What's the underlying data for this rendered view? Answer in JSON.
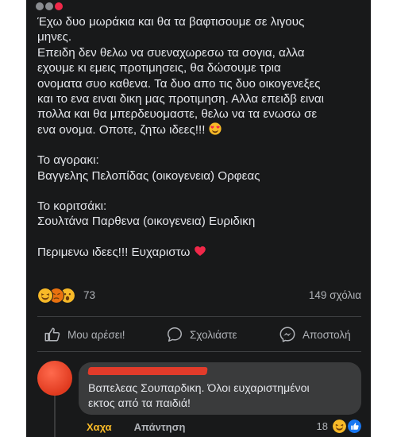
{
  "post": {
    "lines": [
      "Έχω δυο μωράκια και θα τα βαφτισουμε σε λιγους",
      "μηνες.",
      "Επειδη δεν θελω να συεναχωρεσω τα σογια, αλλα",
      "εχουμε κι εμεις προτιμησεις, θα δώσουμε τρια",
      "ονοματα συο καθενα. Τα δυο απο τις δυο οικογενεξες",
      "και το ενα ειναι δικη μας προτιμηση. Αλλα επειδβ ειναι",
      "πολλα και θα μπερδευομαστε, θελω να τα ενωσω σε",
      "ενα ονομα. Οποτε, ζητω ιδεες!!!",
      "Το αγορακι:",
      "Βαγγελης Πελοπίδας (οικογενεια) Ορφεας",
      "Το κοριτσάκι:",
      "Σουλτάνα Παρθενα (οικογενεια) Ευριδικη",
      "Περιμενω ιδεες!!! Ευχαριστω"
    ],
    "reaction_count": "73",
    "comments_count": "149 σχόλια"
  },
  "actions": {
    "like": "Μου αρέσει!",
    "comment": "Σχολιάστε",
    "share": "Αποστολή"
  },
  "comment": {
    "line1": "Βαπελεας Σουπαρδικη. Όλοι ευχαριστημένοι",
    "line2": "εκτος από τα παιδιά!",
    "laugh_label": "Χαχα",
    "reply_label": "Απάντηση",
    "reaction_count": "18"
  },
  "colors": {
    "panel": "#18191a",
    "text": "#e4e6eb",
    "muted": "#b0b3b8",
    "bubble": "#3a3b3c",
    "heart": "#f02849"
  }
}
